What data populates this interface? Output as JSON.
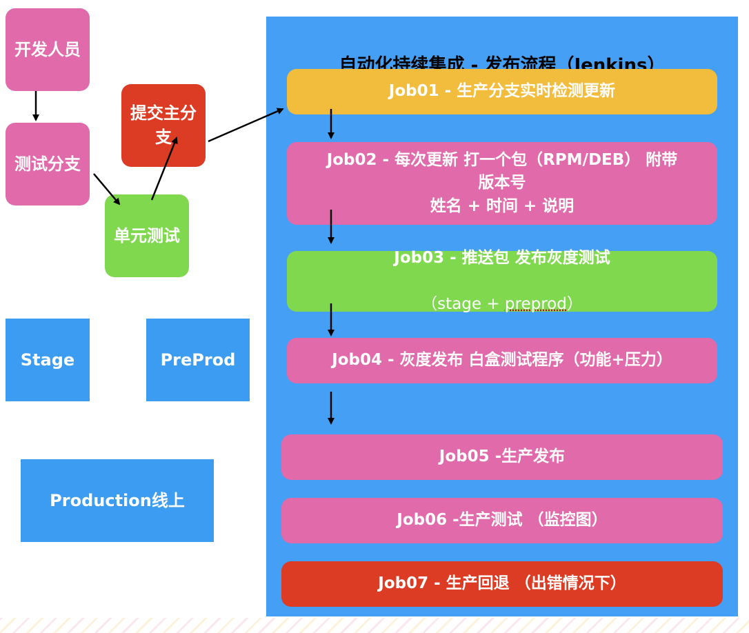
{
  "left_flow": {
    "developer": "开发人员",
    "test_branch": "测试分支",
    "submit_main": "提交主分\n支",
    "unit_test": "单元测试"
  },
  "environments": {
    "stage": "Stage",
    "preprod": "PreProd",
    "production": "Production线上"
  },
  "pipeline": {
    "title": "自动化持续集成 - 发布流程（Jenkins）",
    "jobs": [
      {
        "label": "Job01 - 生产分支实时检测更新",
        "color": "#f2bd3c"
      },
      {
        "label": "Job02 - 每次更新 打一个包（RPM/DEB） 附带\n版本号\n姓名 + 时间 + 说明",
        "color": "#e06aaa"
      },
      {
        "label": "Job03 - 推送包 发布灰度测试",
        "sub_prefix": "（stage + ",
        "sub_underlined": "preprod",
        "sub_suffix": "）",
        "color": "#7fd84e"
      },
      {
        "label": "Job04 - 灰度发布 白盒测试程序（功能+压力）",
        "color": "#e06aaa"
      },
      {
        "label": "Job05 -生产发布",
        "color": "#e06aaa"
      },
      {
        "label": "Job06 -生产测试 （监控图）",
        "color": "#e06aaa"
      },
      {
        "label": "Job07 - 生产回退 （出错情况下）",
        "color": "#dc3b24"
      }
    ]
  },
  "colors": {
    "pipeline_bg": "#459ff4",
    "env_blue": "#3c9cf2",
    "pink": "#e06aaa",
    "red": "#dc3b24",
    "green": "#7fd84e",
    "yellow": "#f2bd3c"
  }
}
